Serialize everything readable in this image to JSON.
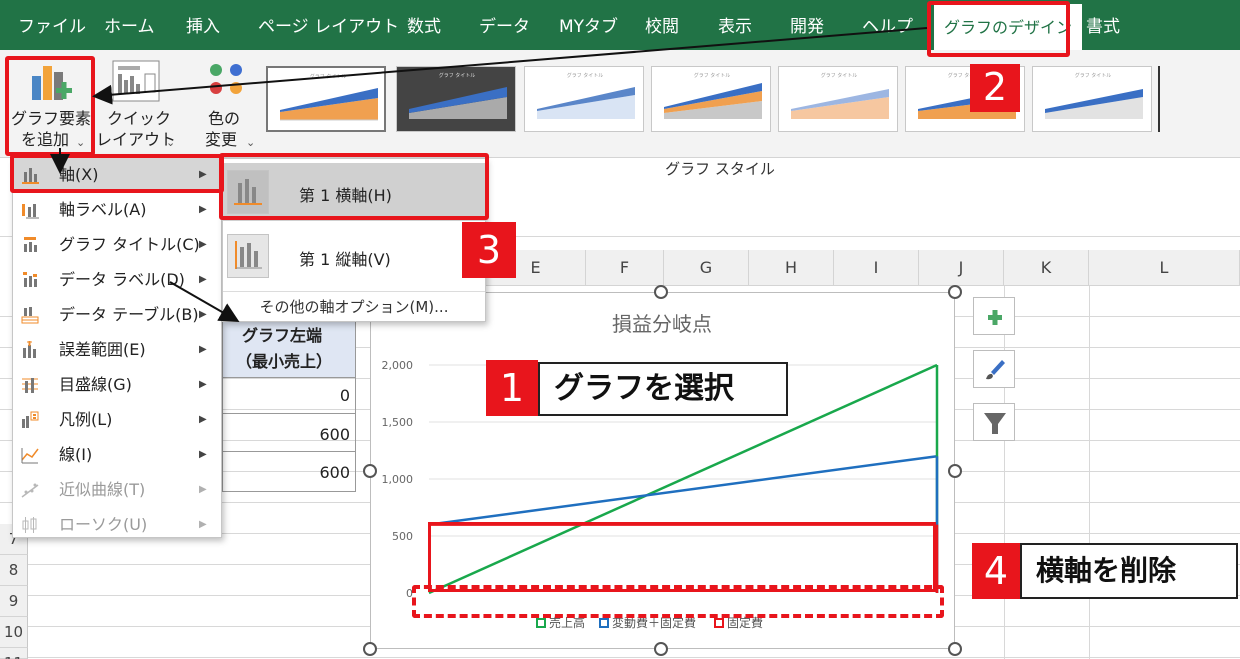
{
  "tabs": [
    {
      "label": "ファイル"
    },
    {
      "label": "ホーム"
    },
    {
      "label": "挿入"
    },
    {
      "label": "ページ レイアウト"
    },
    {
      "label": "数式"
    },
    {
      "label": "データ"
    },
    {
      "label": "MYタブ"
    },
    {
      "label": "校閲"
    },
    {
      "label": "表示"
    },
    {
      "label": "開発"
    },
    {
      "label": "ヘルプ"
    },
    {
      "label": "グラフのデザイン"
    },
    {
      "label": "書式"
    }
  ],
  "ribbon": {
    "add_element": {
      "line1": "グラフ要素",
      "line2": "を追加"
    },
    "quick_layout": {
      "line1": "クイック",
      "line2": "レイアウト"
    },
    "change_color": {
      "line1": "色の",
      "line2": "変更"
    },
    "caret": "⌄",
    "style_group_caption": "グラフ スタイル",
    "style_thumb_title": "グラフ タイトル"
  },
  "menu_main": [
    {
      "label": "軸(X)",
      "icon": "axes-icon"
    },
    {
      "label": "軸ラベル(A)",
      "icon": "axis-title-icon"
    },
    {
      "label": "グラフ タイトル(C)",
      "icon": "chart-title-icon"
    },
    {
      "label": "データ ラベル(D)",
      "icon": "data-labels-icon"
    },
    {
      "label": "データ テーブル(B)",
      "icon": "data-table-icon"
    },
    {
      "label": "誤差範囲(E)",
      "icon": "error-bars-icon"
    },
    {
      "label": "目盛線(G)",
      "icon": "gridlines-icon"
    },
    {
      "label": "凡例(L)",
      "icon": "legend-icon"
    },
    {
      "label": "線(I)",
      "icon": "lines-icon"
    },
    {
      "label": "近似曲線(T)",
      "icon": "trendline-icon"
    },
    {
      "label": "ローソク(U)",
      "icon": "up-down-bars-icon"
    }
  ],
  "menu_sub": {
    "primary_horizontal": "第 1 横軸(H)",
    "primary_vertical": "第 1 縦軸(V)",
    "more_options": "その他の軸オプション(M)..."
  },
  "columns": [
    "E",
    "F",
    "G",
    "H",
    "I",
    "J",
    "K",
    "L"
  ],
  "rows": [
    "7",
    "8",
    "9",
    "10",
    "11"
  ],
  "cells": {
    "header_line1": "グラフ左端",
    "header_line2": "（最小売上）",
    "values": [
      "0",
      "600",
      "600"
    ]
  },
  "chart_data": {
    "type": "line",
    "title": "損益分岐点",
    "x": [
      0,
      1
    ],
    "ylim": [
      0,
      2000
    ],
    "yticks": [
      "2,000",
      "1,500",
      "1,000",
      "500",
      "0"
    ],
    "series": [
      {
        "name": "売上高",
        "color": "#19a84c",
        "values": [
          0,
          2000
        ]
      },
      {
        "name": "変動費＋固定費",
        "color": "#1f6fbf",
        "values": [
          600,
          1200
        ]
      },
      {
        "name": "固定費",
        "color": "#e8151c",
        "values": [
          600,
          600
        ]
      }
    ],
    "legend": "bottom"
  },
  "annotations": {
    "step1": {
      "num": "1",
      "text": "グラフを選択"
    },
    "step2": {
      "num": "2"
    },
    "step3": {
      "num": "3"
    },
    "step4": {
      "num": "4",
      "text": "横軸を削除"
    }
  },
  "colors": {
    "ribbon_green": "#217346",
    "annotation_red": "#e8151c"
  }
}
